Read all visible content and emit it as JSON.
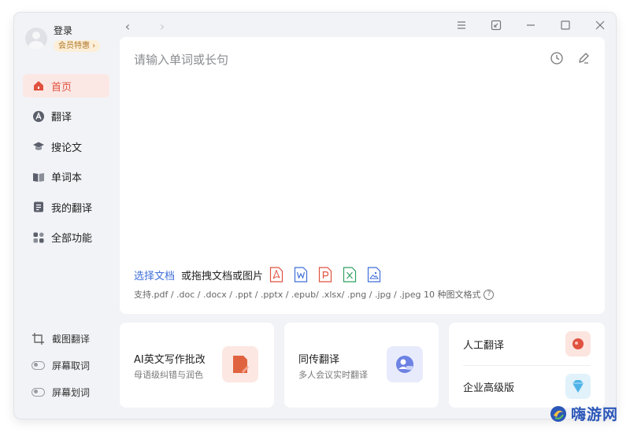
{
  "user": {
    "login_label": "登录",
    "vip_label": "会员特惠 ›"
  },
  "nav": {
    "items": [
      {
        "label": "首页",
        "icon": "home-icon"
      },
      {
        "label": "翻译",
        "icon": "translate-icon"
      },
      {
        "label": "搜论文",
        "icon": "graduation-cap-icon"
      },
      {
        "label": "单词本",
        "icon": "book-icon"
      },
      {
        "label": "我的翻译",
        "icon": "document-icon"
      },
      {
        "label": "全部功能",
        "icon": "grid-icon"
      }
    ],
    "active_index": 0
  },
  "tools": {
    "screenshot_translate": "截图翻译",
    "screen_lookup": "屏幕取词",
    "screen_select": "屏幕划词"
  },
  "input": {
    "placeholder": "请输入单词或长句",
    "select_doc": "选择文档",
    "drag_text": "或拖拽文档或图片",
    "formats": "支持.pdf / .doc / .docx / .ppt / .pptx / .epub/ .xlsx/ .png / .jpg / .jpeg  10 种图文格式",
    "help": "?"
  },
  "cards": {
    "ai_writing": {
      "title": "AI英文写作批改",
      "subtitle": "母语级纠错与润色"
    },
    "simultaneous": {
      "title": "同传翻译",
      "subtitle": "多人会议实时翻译"
    },
    "human": {
      "title": "人工翻译"
    },
    "enterprise": {
      "title": "企业高级版"
    }
  },
  "watermark": {
    "text": "嗨游网"
  },
  "colors": {
    "accent": "#e0523f",
    "link": "#3f6ed8",
    "pdf": "#e0523f",
    "word": "#3f6ed8",
    "ppt": "#e0523f",
    "excel": "#2fa062",
    "image": "#3f6ed8"
  }
}
